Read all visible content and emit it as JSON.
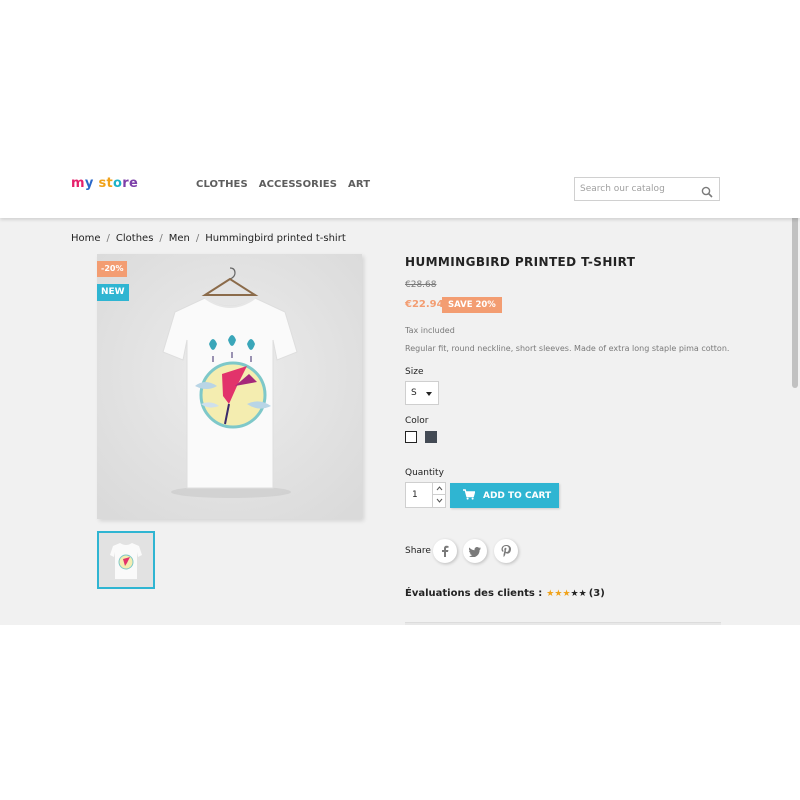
{
  "header": {
    "logo": {
      "part1": "m",
      "part2": "y",
      "part3": " st",
      "part4": "o",
      "part5": "re"
    },
    "nav": [
      "CLOTHES",
      "ACCESSORIES",
      "ART"
    ],
    "search": {
      "placeholder": "Search our catalog",
      "value": ""
    }
  },
  "breadcrumb": [
    "Home",
    "Clothes",
    "Men",
    "Hummingbird printed t-shirt"
  ],
  "product": {
    "title": "HUMMINGBIRD PRINTED T-SHIRT",
    "badge_discount": "-20%",
    "badge_new": "NEW",
    "old_price": "€28.68",
    "new_price": "€22.94",
    "save_label": "SAVE 20%",
    "tax_text": "Tax included",
    "description": "Regular fit, round neckline, short sleeves. Made of extra long staple pima cotton.",
    "size_label": "Size",
    "size_value": "S",
    "color_label": "Color",
    "colors": [
      "#ffffff",
      "#434a54"
    ],
    "quantity_label": "Quantity",
    "quantity_value": "1",
    "add_to_cart": "ADD TO CART",
    "share_label": "Share",
    "share_icons": [
      "facebook-icon",
      "twitter-icon",
      "pinterest-icon"
    ],
    "reviews_label": "Évaluations des clients :",
    "rating": 3,
    "rating_max": 5,
    "reviews_count": "(3)"
  },
  "colors": {
    "accent": "#2fb5d2",
    "discount": "#f39d72",
    "page_bg": "#f1f1f1",
    "star": "#f0a21a"
  }
}
